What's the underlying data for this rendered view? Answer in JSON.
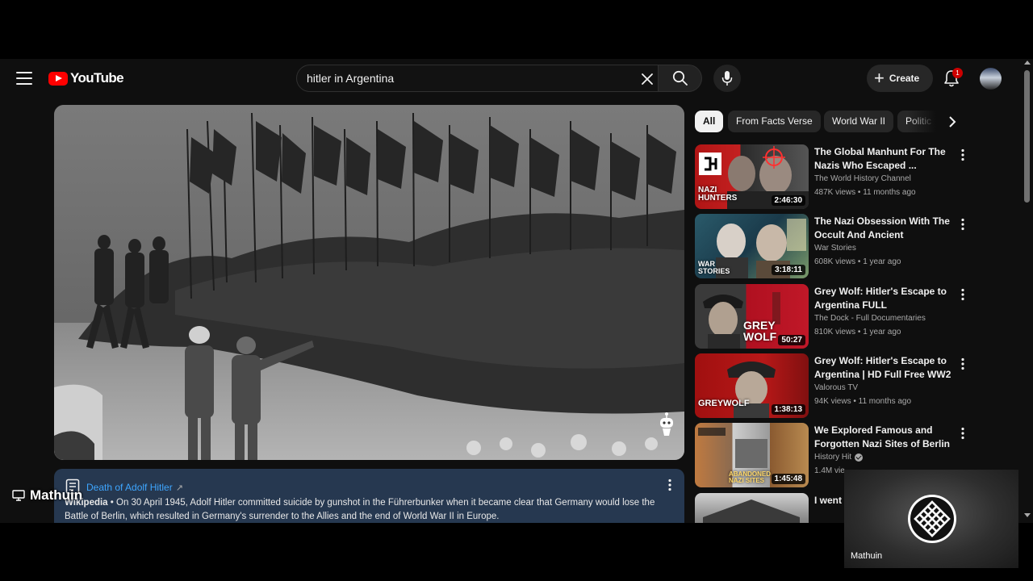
{
  "header": {
    "logo_text": "YouTube",
    "search_value": "hitler in Argentina",
    "create_label": "Create",
    "notification_count": "1"
  },
  "info_card": {
    "title": "Death of Adolf Hitler",
    "ext_icon": "↗",
    "source": "Wikipedia",
    "separator": " • ",
    "text": "On 30 April 1945, Adolf Hitler committed suicide by gunshot in the Führerbunker when it became clear that Germany would lose the Battle of Berlin, which resulted in Germany's surrender to the Allies and the end of World War II in Europe."
  },
  "chips": [
    "All",
    "From Facts Verse",
    "World War II",
    "Politic"
  ],
  "recommendations": [
    {
      "title": "The Global Manhunt For The Nazis Who Escaped ...",
      "channel": "The World History Channel",
      "meta": "487K views • 11 months ago",
      "duration": "2:46:30",
      "thumb_text": "NAZI HUNTERS",
      "verified": false
    },
    {
      "title": "The Nazi Obsession With The Occult And Ancient Mythology...",
      "channel": "War Stories",
      "meta": "608K views • 1 year ago",
      "duration": "3:18:11",
      "thumb_text": "WAR STORIES",
      "verified": false
    },
    {
      "title": "Grey Wolf: Hitler's Escape to Argentina FULL DOCUMENTA...",
      "channel": "The Dock - Full Documentaries",
      "meta": "810K views • 1 year ago",
      "duration": "50:27",
      "thumb_text": "GREY WOLF",
      "verified": false
    },
    {
      "title": "Grey Wolf: Hitler's Escape to Argentina | HD Full Free WW2 ...",
      "channel": "Valorous TV",
      "meta": "94K views • 11 months ago",
      "duration": "1:38:13",
      "thumb_text": "GREYWOLF",
      "verified": false
    },
    {
      "title": "We Explored Famous and Forgotten Nazi Sites of Berlin",
      "channel": "History Hit",
      "meta": "1.4M vie",
      "duration": "1:45:48",
      "thumb_text": "ABANDONED NAZI SITES",
      "verified": true
    },
    {
      "title": "I went t refuge",
      "channel": "",
      "meta": "",
      "duration": "",
      "thumb_text": "",
      "verified": false
    }
  ],
  "overlay": {
    "streamer_name": "Mathuin",
    "webcam_name": "Mathuin"
  }
}
